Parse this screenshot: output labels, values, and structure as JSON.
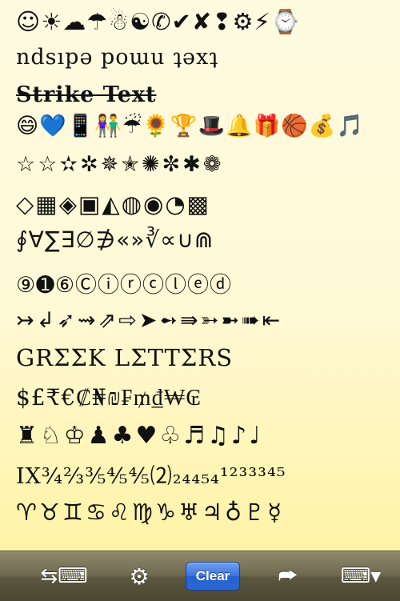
{
  "text_lines": {
    "symbols": "☺☀☁☂☃☯✆✔✘❢⚙⚡⌚",
    "upside_down": "ndsıpǝ poɯu ʇǝxʇ",
    "strike": "Strike Text",
    "emoji": "😄💙📱👫☔🌻🏆🎩🔔🎁🏀💰🎵",
    "stars": "☆☆✫✲✵✭✺✼✱❁",
    "shapes": "◇▦◈▣◭◍◉◔▩",
    "math": "∮∀∑∃∅∌«»∛∝∪⋒",
    "circled": "⑨➊⑥Ⓒⓘⓡⓒⓛⓔⓓ",
    "arrows": "↣↲➶⇝⇗⇨➤➻⇛➳➼➠⇤",
    "greek": "GRΣΣK LΣTTΣRS",
    "currency": "$£₹€₡₦₪₣₥₫₩₢",
    "chess": "♜♘♔♟♣♥♧♬♫♪♩",
    "numbers": "IX¾⅔⅗⅘⅘⑵₂₄₄₅₄¹²³³³⁴⁵",
    "zodiac": "♈♉♊♋♌♍♑♅♃♁♇☿"
  },
  "toolbar": {
    "swap_icon": "⇆⌨",
    "gear_icon": "⚙",
    "clear_label": "Clear",
    "share_icon": "⮫",
    "keyboard_icon": "⌨▾"
  }
}
